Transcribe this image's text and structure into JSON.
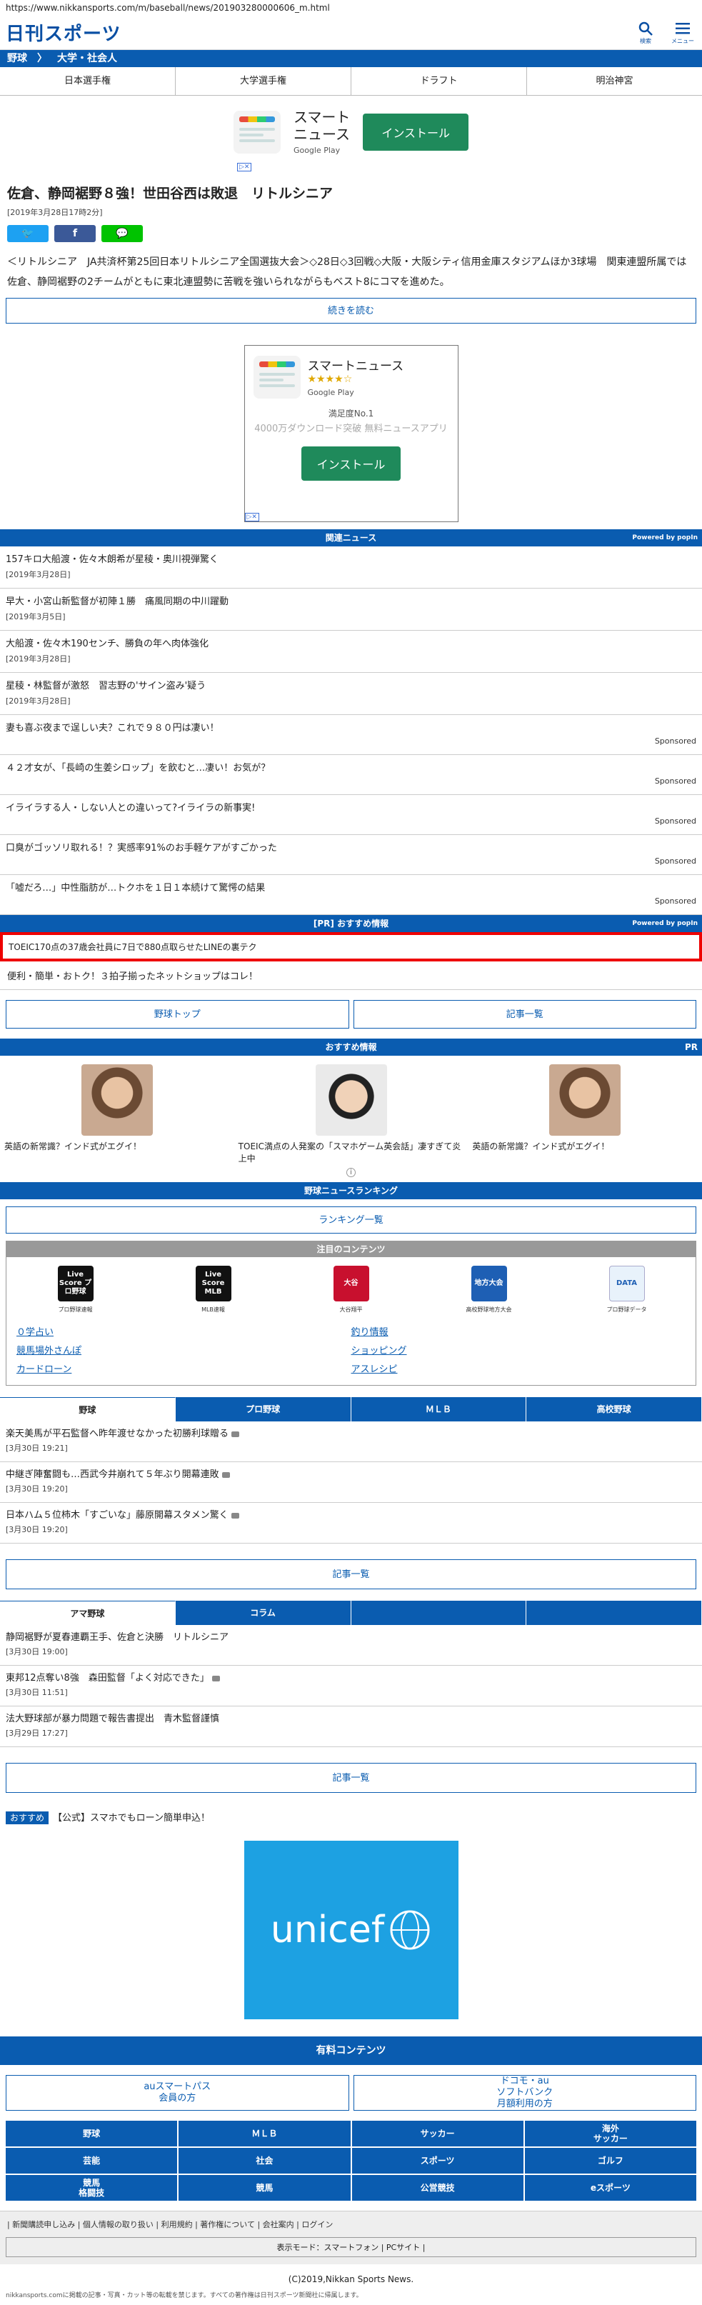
{
  "url": "https://www.nikkansports.com/m/baseball/news/201903280000606_m.html",
  "header": {
    "logo": "日刊スポーツ",
    "search_label": "検索",
    "menu_label": "メニュー"
  },
  "breadcrumb": {
    "items": [
      "野球",
      "〉",
      "大学・社会人"
    ]
  },
  "subnav": [
    "日本選手権",
    "大学選手権",
    "ドラフト",
    "明治神宮"
  ],
  "ad_top": {
    "name_line1": "スマート",
    "name_line2": "ニュース",
    "store": "Google Play",
    "install": "インストール"
  },
  "article": {
    "title": "佐倉、静岡裾野８強！世田谷西は敗退　リトルシニア",
    "date": "[2019年3月28日17時2分]",
    "lead": "＜リトルシニア　JA共済杯第25回日本リトルシニア全国選抜大会＞◇28日◇3回戦◇大阪・大阪シティ信用金庫スタジアムほか3球場　関東連盟所属では佐倉、静岡裾野の2チームがともに東北連盟勢に苦戦を強いられながらもベスト8にコマを進めた。",
    "read_more": "続きを読む"
  },
  "ad_box": {
    "name": "スマートニュース",
    "stars": "★★★★☆",
    "store": "Google Play",
    "line1": "満足度No.1",
    "line2": "4000万ダウンロード突破 無料ニュースアプリ",
    "install": "インストール"
  },
  "related": {
    "head": "関連ニュース",
    "powered": "Powered by popIn",
    "items": [
      {
        "title": "157キロ大船渡・佐々木朗希が星稜・奥川視弾驚く",
        "date": "[2019年3月28日]"
      },
      {
        "title": "早大・小宮山新監督が初陣１勝　痛風同期の中川躍動",
        "date": "[2019年3月5日]"
      },
      {
        "title": "大船渡・佐々木190センチ、勝負の年へ肉体強化",
        "date": "[2019年3月28日]"
      },
      {
        "title": "星稜・林監督が激怒　習志野の'サイン盗み'疑う",
        "date": "[2019年3月28日]"
      }
    ],
    "sponsored_label": "Sponsored",
    "sponsored": [
      "妻も喜ぶ夜まで逞しい夫？これで９８０円は凄い！",
      "４２才女が、「長崎の生姜シロップ」を飲むと…凄い！お気が？",
      "イライラする人・しない人との違いって?イライラの新事実!",
      "口臭がゴッソリ取れる！？実感率91%のお手軽ケアがすごかった",
      "「嘘だろ…」中性脂肪が…トクホを１日１本続けて驚愕の結果"
    ]
  },
  "pr": {
    "head": "[PR] おすすめ情報",
    "powered": "Powered by popIn",
    "highlight": "TOEIC170点の37歳会社員に7日で880点取らせたLINEの裏テク",
    "item": "便利・簡単・おトク！３拍子揃ったネットショップはコレ！"
  },
  "nav_buttons": {
    "left": "野球トップ",
    "right": "記事一覧"
  },
  "recommend": {
    "head": "おすすめ情報",
    "pr": "PR",
    "items": [
      "英語の新常識？インド式がエグイ！",
      "TOEIC満点の人発案の「スマホゲーム英会話」凄すぎて炎上中",
      "英語の新常識？インド式がエグイ！"
    ],
    "info": "i"
  },
  "ranking": {
    "head": "野球ニュースランキング",
    "button": "ランキング一覧"
  },
  "contents": {
    "head": "注目のコンテンツ",
    "icons": [
      {
        "label": "Live Score プロ野球",
        "cap": "プロ野球速報"
      },
      {
        "label": "Live Score MLB",
        "cap": "MLB速報"
      },
      {
        "label": "大谷",
        "cap": "大谷翔平"
      },
      {
        "label": "地方大会",
        "cap": "高校野球地方大会"
      },
      {
        "label": "DATA",
        "cap": "プロ野球データ"
      }
    ],
    "links": [
      "０学占い",
      "釣り情報",
      "競馬場外さんぽ",
      "ショッピング",
      "カードローン",
      "アスレシピ"
    ]
  },
  "tabs1": {
    "items": [
      "野球",
      "プロ野球",
      "ＭＬＢ",
      "高校野球"
    ],
    "articles": [
      {
        "title": "楽天美馬が平石監督へ昨年渡せなかった初勝利球贈る",
        "date": "[3月30日 19:21]"
      },
      {
        "title": "中継ぎ陣奮闘も…西武今井崩れて５年ぶり開幕連敗",
        "date": "[3月30日 19:20]"
      },
      {
        "title": "日本ハム５位柿木「すごいな」藤原開幕スタメン驚く",
        "date": "[3月30日 19:20]"
      }
    ],
    "button": "記事一覧"
  },
  "tabs2": {
    "items": [
      "アマ野球",
      "コラム",
      "",
      ""
    ],
    "articles": [
      {
        "title": "静岡裾野が夏春連覇王手、佐倉と決勝　リトルシニア",
        "date": "[3月30日 19:00]"
      },
      {
        "title": "東邦12点奪い8強　森田監督「よく対応できた」",
        "date": "[3月30日 11:51]"
      },
      {
        "title": "法大野球部が暴力問題で報告書提出　青木監督謹慎",
        "date": "[3月29日 17:27]"
      }
    ],
    "button": "記事一覧"
  },
  "osusume": {
    "tag": "おすすめ",
    "text": "【公式】スマホでもローン簡単申込！"
  },
  "unicef": {
    "text": "unicef"
  },
  "paid": {
    "head": "有料コンテンツ",
    "left": "auスマートパス\n会員の方",
    "right": "ドコモ・au\nソフトバンク\n月額利用の方"
  },
  "footnav": [
    "野球",
    "ＭＬＢ",
    "サッカー",
    "海外\nサッカー",
    "芸能",
    "社会",
    "スポーツ",
    "ゴルフ",
    "競馬\n格闘技",
    "競馬",
    "公営競技",
    "eスポーツ"
  ],
  "footlinks": "| 新聞購読申し込み | 個人情報の取り扱い | 利用規約 | 著作権について | 会社案内 | ログイン",
  "mode": "表示モード：スマートフォン | PCサイト |",
  "copyright": "(C)2019,Nikkan Sports News.",
  "notice": "nikkansports.comに掲載の記事・写真・カット等の転載を禁じます。すべての著作権は日刊スポーツ新聞社に帰属します。"
}
